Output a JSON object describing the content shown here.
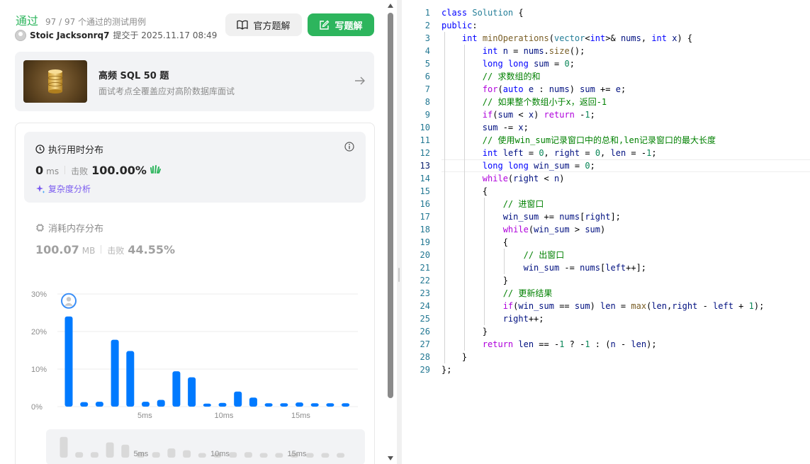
{
  "result": {
    "status": "通过",
    "testcases": "97 / 97 个通过的测试用例",
    "user": "Stoic Jacksonrq7",
    "submitted": "提交于 2025.11.17 08:49"
  },
  "buttons": {
    "official": "官方题解",
    "write": "写题解"
  },
  "banner": {
    "title": "高频 SQL 50 题",
    "subtitle": "面试考点全覆盖应对高阶数据库面试"
  },
  "runtime": {
    "title": "执行用时分布",
    "value": "0",
    "unit": "ms",
    "beat_label": "击败",
    "beat": "100.00%",
    "complexity": "复杂度分析"
  },
  "memory": {
    "title": "消耗内存分布",
    "value": "100.07",
    "unit": "MB",
    "beat_label": "击败",
    "beat": "44.55%"
  },
  "colors": {
    "accent_green": "#2db55d",
    "bar_blue": "#007aff",
    "purple": "#7b5cf0"
  },
  "chart_data": {
    "type": "bar",
    "title": "",
    "xlabel": "",
    "ylabel": "",
    "x_ticks": [
      "5ms",
      "10ms",
      "15ms"
    ],
    "y_ticks": [
      "30%",
      "20%",
      "10%",
      "0%"
    ],
    "ylim": [
      0,
      30
    ],
    "grid": true,
    "categories": [
      "0",
      "1",
      "2",
      "3",
      "4",
      "5",
      "6",
      "7",
      "8",
      "9",
      "10",
      "11",
      "12",
      "13",
      "14",
      "15",
      "16",
      "17",
      "18"
    ],
    "values": [
      24,
      1.2,
      1.3,
      17.8,
      14.8,
      1.3,
      1.8,
      9.4,
      7.8,
      0.8,
      1,
      4,
      2.4,
      0.9,
      0.9,
      1.1,
      0.9,
      0.9,
      0.9
    ],
    "highlighted_index": 0,
    "mini_values": [
      4.5,
      1.2,
      1.2,
      3.3,
      2.8,
      1.2,
      1.2,
      2,
      1.6,
      1,
      1,
      1.2,
      1.2,
      1,
      1,
      1,
      1,
      1,
      1
    ]
  },
  "editor": {
    "active_line": 13,
    "lines": [
      "class Solution {",
      "public:",
      "    int minOperations(vector<int>& nums, int x) {",
      "        int n = nums.size();",
      "        long long sum = 0;",
      "        // 求数组的和",
      "        for(auto e : nums) sum += e;",
      "        // 如果整个数组小于x，返回-1",
      "        if(sum < x) return -1;",
      "        sum -= x;",
      "        // 使用win_sum记录窗口中的总和,len记录窗口的最大长度",
      "        int left = 0, right = 0, len = -1;",
      "        long long win_sum = 0;",
      "        while(right < n)",
      "        {",
      "            // 进窗口",
      "            win_sum += nums[right];",
      "            while(win_sum > sum)",
      "            {",
      "                // 出窗口",
      "                win_sum -= nums[left++];",
      "            }",
      "            // 更新结果",
      "            if(win_sum == sum) len = max(len,right - left + 1);",
      "            right++;",
      "        }",
      "        return len == -1 ? -1 : (n - len);",
      "    }",
      "};"
    ]
  }
}
